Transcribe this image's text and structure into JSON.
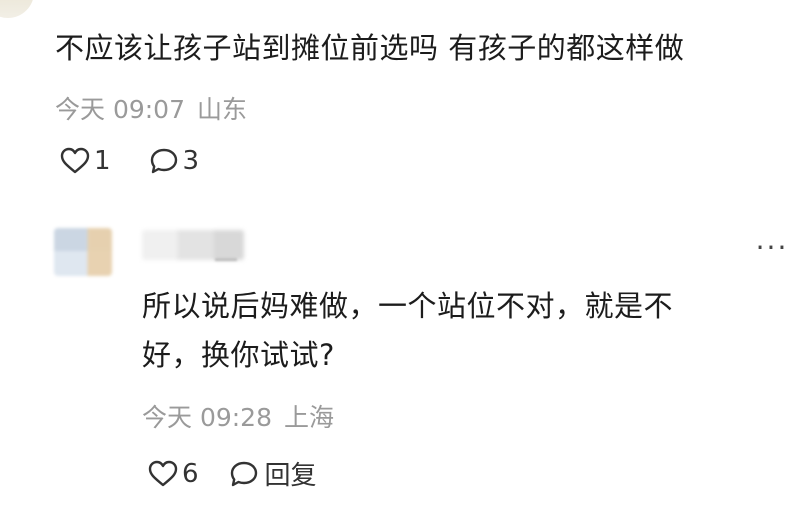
{
  "comment": {
    "text": "不应该让孩子站到摊位前选吗 有孩子的都这样做",
    "time": "今天 09:07",
    "location": "山东",
    "likes": "1",
    "replies": "3"
  },
  "reply": {
    "text_line1": "所以说后妈难做，一个站位不对，就是不",
    "text_line2": "好，换你试试?",
    "time": "今天 09:28",
    "location": "上海",
    "likes": "6",
    "reply_label": "回复",
    "more_label": "···"
  },
  "icons": {
    "like": "heart-outline-icon",
    "comment": "speech-bubble-icon",
    "more": "ellipsis-icon"
  },
  "colors": {
    "text": "#1c1c1c",
    "meta": "#9a9a9a",
    "icon": "#333333"
  }
}
